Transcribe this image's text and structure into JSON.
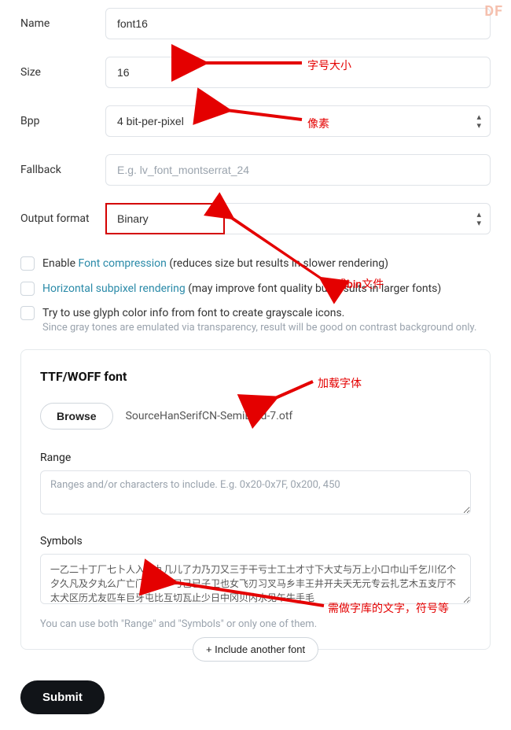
{
  "watermark": "DF",
  "fields": {
    "name": {
      "label": "Name",
      "value": "font16"
    },
    "size": {
      "label": "Size",
      "value": "16"
    },
    "bpp": {
      "label": "Bpp",
      "value": "4 bit-per-pixel"
    },
    "fallback": {
      "label": "Fallback",
      "placeholder": "E.g. lv_font_montserrat_24"
    },
    "output": {
      "label": "Output format",
      "value": "Binary"
    }
  },
  "checkboxes": {
    "compress": {
      "prefix": "Enable ",
      "link": "Font compression",
      "suffix": " (reduces size but results in slower rendering)"
    },
    "subpixel": {
      "link": "Horizontal subpixel rendering",
      "suffix": " (may improve font quality but results in larger fonts)"
    },
    "glyph": {
      "text": "Try to use glyph color info from font to create grayscale icons."
    },
    "glyph_hint": "Since gray tones are emulated via transparency, result will be good on contrast background only."
  },
  "card": {
    "title": "TTF/WOFF font",
    "browse": "Browse",
    "file": "SourceHanSerifCN-SemiBold-7.otf",
    "range_label": "Range",
    "range_placeholder": "Ranges and/or characters to include. E.g. 0x20-0x7F, 0x200, 450",
    "symbols_label": "Symbols",
    "symbols_value": "一乙二十丁厂七卜人入八九几儿了力乃刀又三于干亏士工土才寸下大丈与万上小口巾山千乞川亿个夕久凡及夕丸么广亡门义之尸弓己已子卫也女飞刃习叉马乡丰王井开夫天无元专云扎艺木五支厅不太犬区历尤友匹车巨牙屯比互切瓦止少日中冈贝内水见午牛手毛",
    "hint": "You can use both \"Range\" and \"Symbols\" or only one of them."
  },
  "include_button": "+  Include another font",
  "submit": "Submit",
  "annotations": {
    "size": "字号大小",
    "bpp": "像素",
    "output": "生成bin文件",
    "font": "加载字体",
    "symbols": "需做字库的文字，符号等"
  },
  "colors": {
    "accent_red": "#e40000",
    "link": "#2a8aa8"
  }
}
